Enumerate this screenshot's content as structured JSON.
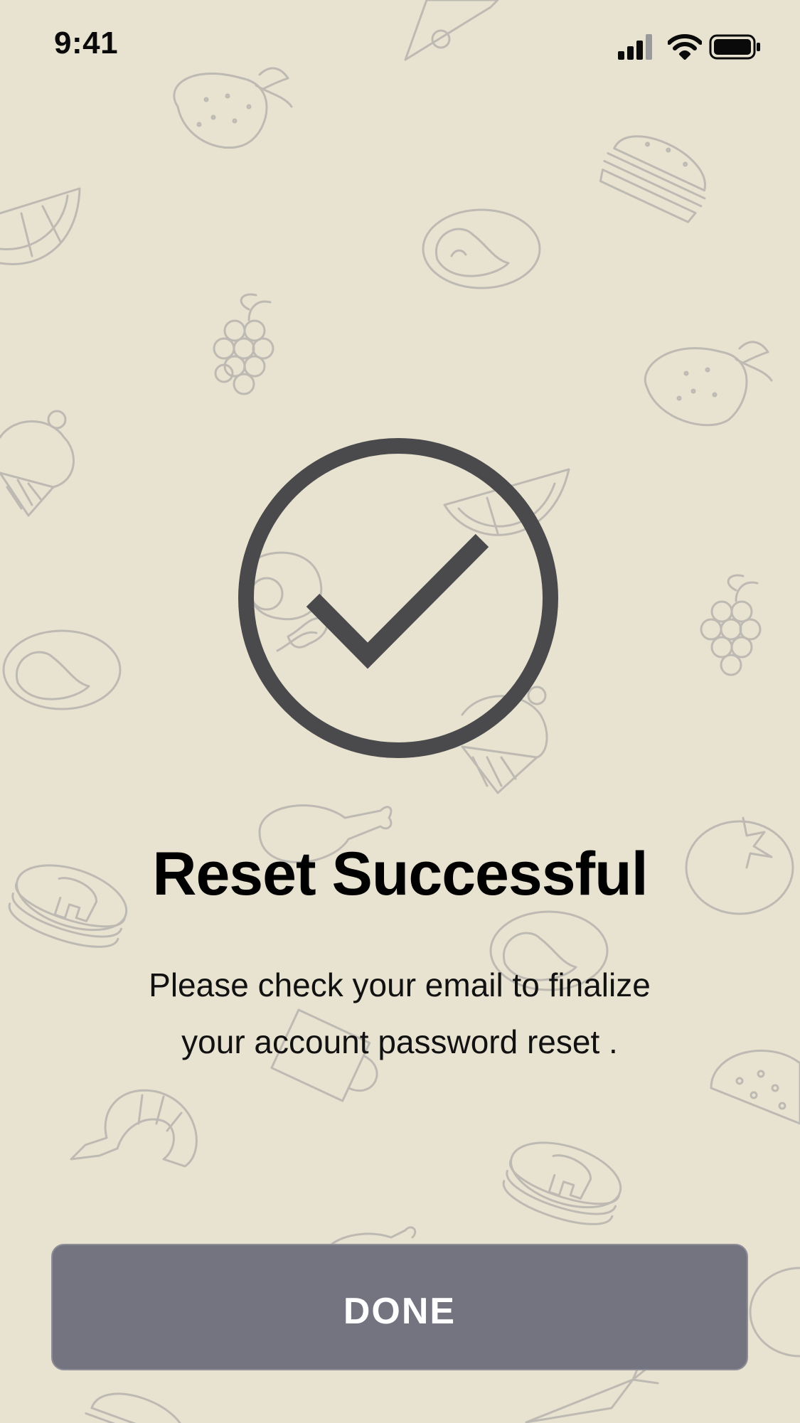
{
  "status_bar": {
    "time": "9:41",
    "icons": [
      "cellular-signal-icon",
      "wifi-icon",
      "battery-icon"
    ]
  },
  "success": {
    "icon": "checkmark-circle-icon",
    "title": "Reset Successful",
    "message_lines": [
      "Please check your email to finalize",
      "your account password reset ."
    ]
  },
  "actions": {
    "done_label": "DONE"
  },
  "colors": {
    "background": "#e8e2d0",
    "pattern_stroke": "#bdbab3",
    "icon_stroke": "#4a4a4c",
    "button_bg": "#737480",
    "button_text": "#ffffff"
  },
  "background_pattern_icons": [
    "pizza-slice-icon",
    "strawberry-icon",
    "burger-icon",
    "orange-slice-icon",
    "steak-icon",
    "grapes-icon",
    "cupcake-icon",
    "fried-egg-bacon-icon",
    "chicken-leg-icon",
    "pancakes-icon",
    "tomato-icon",
    "mug-icon",
    "shrimp-icon",
    "taco-icon",
    "carrot-icon"
  ]
}
